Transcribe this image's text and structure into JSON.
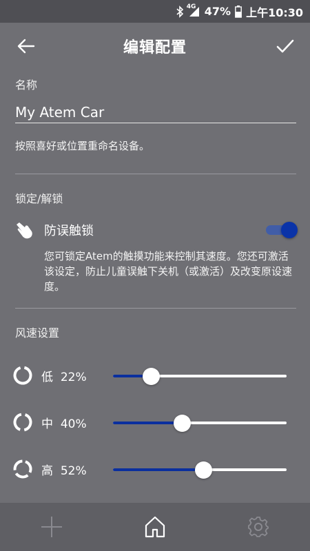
{
  "status_bar": {
    "network": "4G",
    "battery": "47%",
    "time": "上午10:30"
  },
  "app_bar": {
    "title": "编辑配置",
    "back_icon": "arrow-left-icon",
    "confirm_icon": "check-icon"
  },
  "name_section": {
    "label": "名称",
    "value": "My Atem Car",
    "helper": "按照喜好或位置重命名设备。"
  },
  "lock_section": {
    "label": "锁定/解锁",
    "toggle_label": "防误触锁",
    "toggle_on": true,
    "description": "您可锁定Atem的触摸功能来控制其速度。您还可激活该设定，防止儿童误触下关机（或激活）及改变原设速度。"
  },
  "speed_section": {
    "label": "风速设置",
    "levels": [
      {
        "name": "低",
        "percent_text": "22%",
        "value": 0.22
      },
      {
        "name": "中",
        "percent_text": "40%",
        "value": 0.4
      },
      {
        "name": "高",
        "percent_text": "52%",
        "value": 0.52
      }
    ]
  },
  "bottom_nav": {
    "items": [
      "add-icon",
      "home-icon",
      "settings-gear-icon"
    ]
  },
  "colors": {
    "background": "#6f6f74",
    "accent": "#0a2f9e",
    "status_bar": "#4f4f54"
  }
}
